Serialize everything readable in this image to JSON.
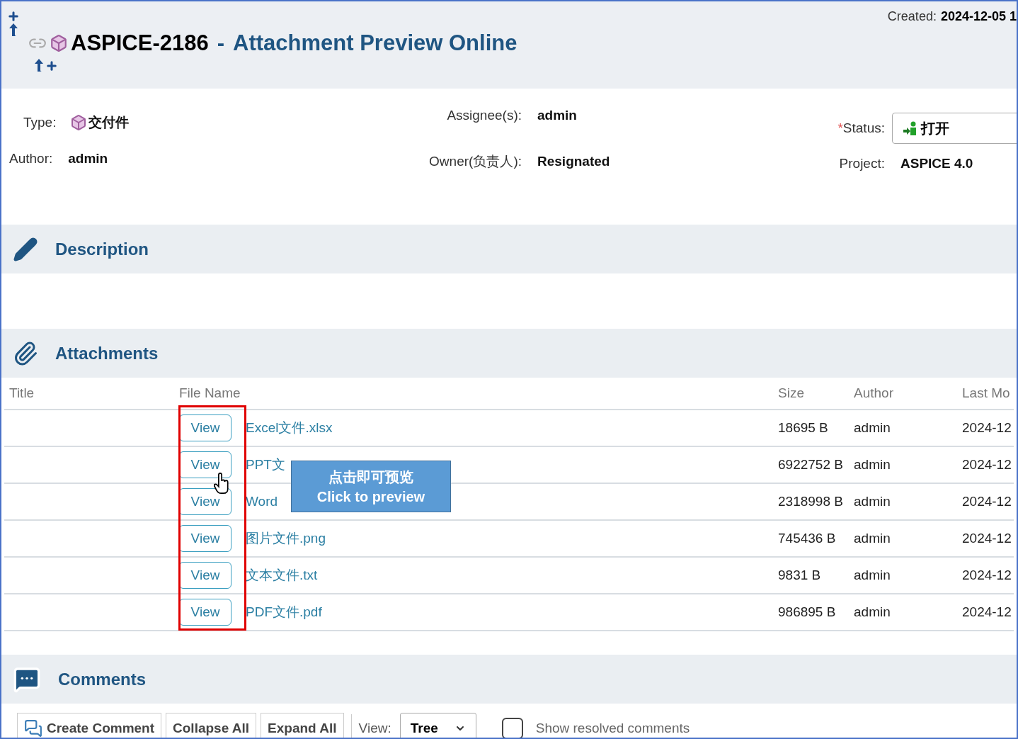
{
  "header": {
    "id": "ASPICE-2186",
    "separator": "-",
    "title": "Attachment Preview Online",
    "created_label": "Created:",
    "created_value": "2024-12-05 1"
  },
  "fields": {
    "type": {
      "label": "Type:",
      "value": "交付件"
    },
    "author": {
      "label": "Author:",
      "value": "admin"
    },
    "assignee": {
      "label": "Assignee(s):",
      "value": "admin"
    },
    "owner": {
      "label": "Owner(负责人):",
      "value": "Resignated"
    },
    "status": {
      "required_mark": "*",
      "label": "Status:",
      "value": "打开"
    },
    "project": {
      "label": "Project:",
      "value": "ASPICE 4.0"
    }
  },
  "description": {
    "title": "Description"
  },
  "attachments": {
    "title": "Attachments",
    "columns": [
      "Title",
      "File Name",
      "Size",
      "Author",
      "Last Mo"
    ],
    "rows": [
      {
        "action": "View",
        "file": "Excel文件.xlsx",
        "size": "18695 B",
        "author": "admin",
        "modified": "2024-12"
      },
      {
        "action": "View",
        "file": "PPT文",
        "size": "6922752 B",
        "author": "admin",
        "modified": "2024-12"
      },
      {
        "action": "View",
        "file": "Word",
        "size": "2318998 B",
        "author": "admin",
        "modified": "2024-12"
      },
      {
        "action": "View",
        "file": "图片文件.png",
        "size": "745436 B",
        "author": "admin",
        "modified": "2024-12"
      },
      {
        "action": "View",
        "file": "文本文件.txt",
        "size": "9831 B",
        "author": "admin",
        "modified": "2024-12"
      },
      {
        "action": "View",
        "file": "PDF文件.pdf",
        "size": "986895 B",
        "author": "admin",
        "modified": "2024-12"
      }
    ],
    "tooltip": [
      "点击即可预览",
      "Click to preview"
    ]
  },
  "comments": {
    "title": "Comments",
    "buttons": [
      "Create Comment",
      "Collapse All",
      "Expand All"
    ],
    "view_label": "View:",
    "view_value": "Tree",
    "show_resolved": {
      "label": "Show resolved comments",
      "checked": false
    }
  }
}
